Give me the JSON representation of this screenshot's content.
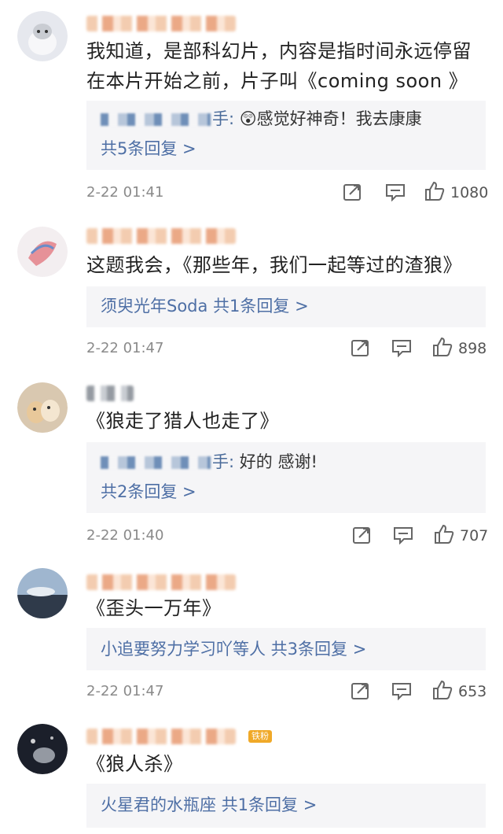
{
  "comments": [
    {
      "text": "我知道，是部科幻片，内容是指时间永远停留在本片开始之前，片子叫《coming soon 》",
      "reply_suffix": "手: ",
      "reply_emoji": "😲",
      "reply_text": "感觉好神奇！我去康康",
      "reply_link": "共5条回复 >",
      "time": "2-22 01:41",
      "likes": "1080"
    },
    {
      "text": "这题我会，《那些年，我们一起等过的渣狼》",
      "reply_link": "须臾光年Soda  共1条回复 >",
      "time": "2-22 01:47",
      "likes": "898"
    },
    {
      "text": "《狼走了猎人也走了》",
      "reply_suffix": "手: ",
      "reply_text": "好的 感谢!",
      "reply_link": "共2条回复 >",
      "time": "2-22 01:40",
      "likes": "707"
    },
    {
      "text": "《歪头一万年》",
      "reply_link": "小追要努力学习吖等人  共3条回复 >",
      "time": "2-22 01:47",
      "likes": "653"
    },
    {
      "text": "《狼人杀》",
      "badge": "铁粉",
      "reply_link": "火星君的水瓶座  共1条回复 >"
    }
  ],
  "colors": {
    "link": "#4e6fa5",
    "reply_bg": "#f5f5f7",
    "meta": "#8a8a8a"
  },
  "icons": [
    "share-icon",
    "comment-icon",
    "like-icon"
  ]
}
